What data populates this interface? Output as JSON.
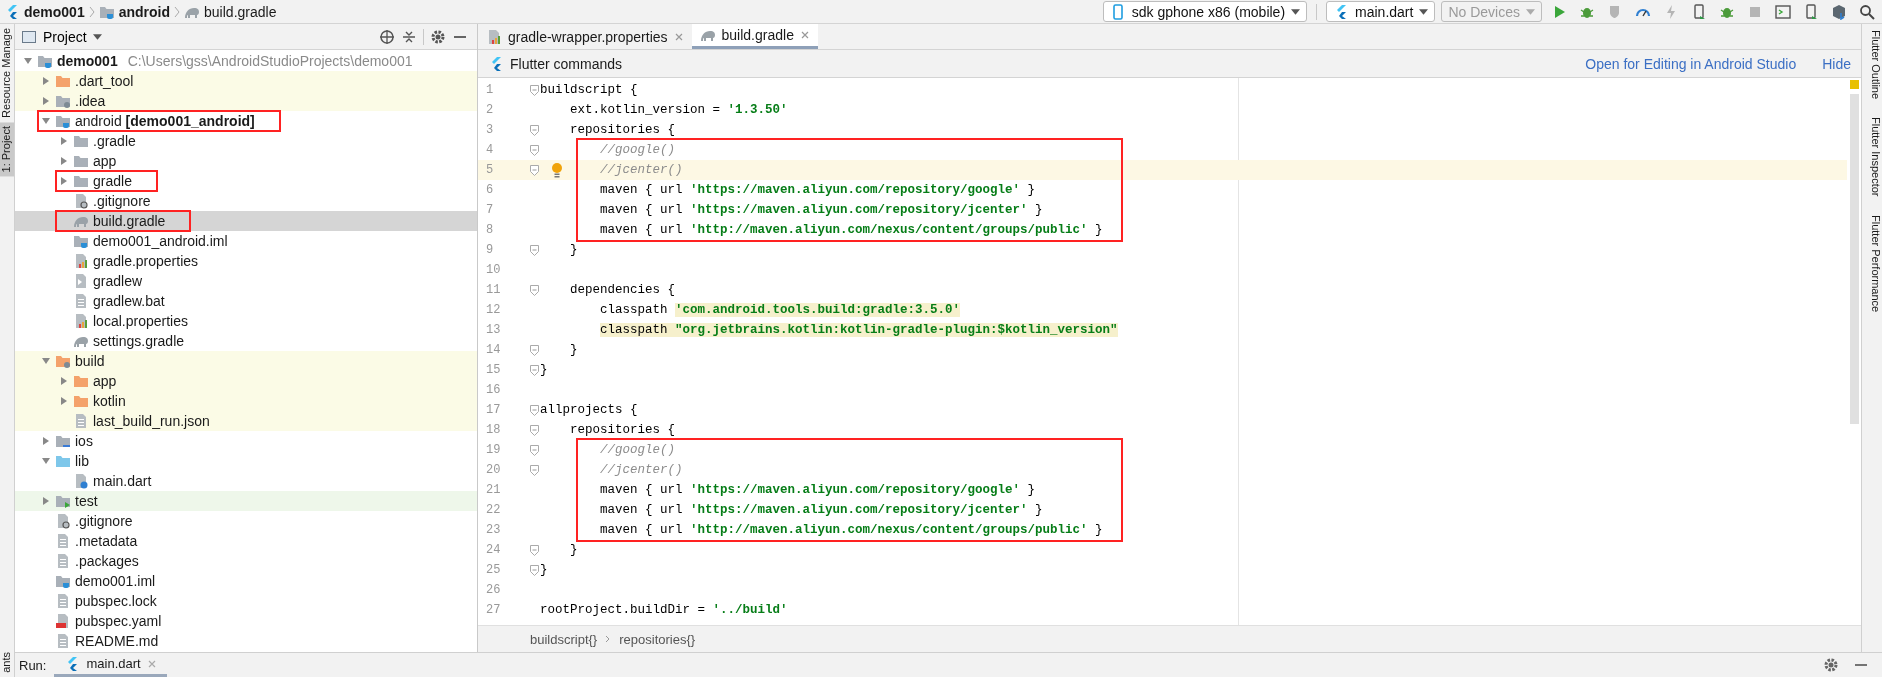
{
  "breadcrumbs": [
    {
      "label": "demo001",
      "kind": "flutter",
      "bold": true
    },
    {
      "label": "android",
      "kind": "module",
      "bold": true
    },
    {
      "label": "build.gradle",
      "kind": "gradle",
      "bold": false
    }
  ],
  "toolbar": {
    "device": "sdk gphone x86 (mobile)",
    "config": "main.dart",
    "target": {
      "label": "No Devices",
      "disabled": true
    },
    "actions": [
      {
        "kind": "run",
        "disabled": false
      },
      {
        "kind": "debug",
        "disabled": false
      },
      {
        "kind": "coverage",
        "disabled": true
      },
      {
        "kind": "profile",
        "disabled": false
      },
      {
        "kind": "reload",
        "disabled": true
      },
      {
        "kind": "attach",
        "disabled": false
      },
      {
        "kind": "debug-attach",
        "disabled": false
      },
      {
        "kind": "stop",
        "disabled": true
      },
      {
        "kind": "terminal",
        "disabled": false
      },
      {
        "kind": "device",
        "disabled": false
      },
      {
        "kind": "package",
        "disabled": false
      },
      {
        "kind": "search",
        "disabled": false
      }
    ]
  },
  "left_strip": {
    "top": [
      {
        "label": "Resource Manage",
        "selected": false
      },
      {
        "label": "1: Project",
        "selected": true
      }
    ],
    "bottom": [
      {
        "label": "ants",
        "selected": false
      }
    ]
  },
  "project_panel": {
    "title": "Project",
    "tree": [
      {
        "label": "demo001",
        "bold": true,
        "note": "C:\\Users\\gss\\AndroidStudioProjects\\demo001",
        "kind": "module",
        "expanded": true,
        "excluded": false,
        "test_root": false,
        "selected": false,
        "annotated": false,
        "children": [
          {
            "label": ".dart_tool",
            "bold": false,
            "kind": "folder-orange",
            "expanded": false,
            "excluded": true,
            "test_root": false,
            "selected": false,
            "annotated": false
          },
          {
            "label": ".idea",
            "bold": false,
            "kind": "folder-gear",
            "expanded": false,
            "excluded": true,
            "test_root": false,
            "selected": false,
            "annotated": false
          },
          {
            "label": "android **[demo001_android]**",
            "bold": false,
            "kind": "module",
            "expanded": true,
            "excluded": false,
            "test_root": false,
            "selected": false,
            "annotated": true,
            "children": [
              {
                "label": ".gradle",
                "bold": false,
                "kind": "folder",
                "expanded": false,
                "excluded": false,
                "test_root": false,
                "selected": false,
                "annotated": false
              },
              {
                "label": "app",
                "bold": false,
                "kind": "folder",
                "expanded": false,
                "excluded": false,
                "test_root": false,
                "selected": false,
                "annotated": false
              },
              {
                "label": "gradle",
                "bold": false,
                "kind": "folder",
                "expanded": false,
                "excluded": false,
                "test_root": false,
                "selected": false,
                "annotated": true
              },
              {
                "label": ".gitignore",
                "bold": false,
                "kind": "ignore",
                "excluded": false,
                "test_root": false,
                "selected": false,
                "annotated": false
              },
              {
                "label": "build.gradle",
                "bold": false,
                "kind": "gradle",
                "excluded": false,
                "test_root": false,
                "selected": true,
                "annotated": true
              },
              {
                "label": "demo001_android.iml",
                "bold": false,
                "kind": "iml",
                "excluded": false,
                "test_root": false,
                "selected": false,
                "annotated": false
              },
              {
                "label": "gradle.properties",
                "bold": false,
                "kind": "properties",
                "excluded": false,
                "test_root": false,
                "selected": false,
                "annotated": false
              },
              {
                "label": "gradlew",
                "bold": false,
                "kind": "script",
                "excluded": false,
                "test_root": false,
                "selected": false,
                "annotated": false
              },
              {
                "label": "gradlew.bat",
                "bold": false,
                "kind": "text",
                "excluded": false,
                "test_root": false,
                "selected": false,
                "annotated": false
              },
              {
                "label": "local.properties",
                "bold": false,
                "kind": "properties",
                "excluded": false,
                "test_root": false,
                "selected": false,
                "annotated": false
              },
              {
                "label": "settings.gradle",
                "bold": false,
                "kind": "gradle",
                "excluded": false,
                "test_root": false,
                "selected": false,
                "annotated": false
              }
            ]
          },
          {
            "label": "build",
            "bold": false,
            "kind": "folder-orange-gear",
            "expanded": true,
            "excluded": true,
            "test_root": false,
            "selected": false,
            "annotated": false,
            "children": [
              {
                "label": "app",
                "bold": false,
                "kind": "folder-orange",
                "expanded": false,
                "excluded": true,
                "test_root": false,
                "selected": false,
                "annotated": false
              },
              {
                "label": "kotlin",
                "bold": false,
                "kind": "folder-orange",
                "expanded": false,
                "excluded": true,
                "test_root": false,
                "selected": false,
                "annotated": false
              },
              {
                "label": "last_build_run.json",
                "bold": false,
                "kind": "json",
                "excluded": true,
                "test_root": false,
                "selected": false,
                "annotated": false
              }
            ]
          },
          {
            "label": "ios",
            "bold": false,
            "kind": "folder-ios",
            "expanded": false,
            "excluded": false,
            "test_root": false,
            "selected": false,
            "annotated": false
          },
          {
            "label": "lib",
            "bold": false,
            "kind": "folder-blue",
            "expanded": true,
            "excluded": false,
            "test_root": false,
            "selected": false,
            "annotated": false,
            "children": [
              {
                "label": "main.dart",
                "bold": false,
                "kind": "dart",
                "excluded": false,
                "test_root": false,
                "selected": false,
                "annotated": false
              }
            ]
          },
          {
            "label": "test",
            "bold": false,
            "kind": "folder-test",
            "expanded": false,
            "excluded": false,
            "test_root": true,
            "selected": false,
            "annotated": false
          },
          {
            "label": ".gitignore",
            "bold": false,
            "kind": "ignore",
            "excluded": false,
            "test_root": false,
            "selected": false,
            "annotated": false
          },
          {
            "label": ".metadata",
            "bold": false,
            "kind": "text",
            "excluded": false,
            "test_root": false,
            "selected": false,
            "annotated": false
          },
          {
            "label": ".packages",
            "bold": false,
            "kind": "text",
            "excluded": false,
            "test_root": false,
            "selected": false,
            "annotated": false
          },
          {
            "label": "demo001.iml",
            "bold": false,
            "kind": "iml",
            "excluded": false,
            "test_root": false,
            "selected": false,
            "annotated": false
          },
          {
            "label": "pubspec.lock",
            "bold": false,
            "kind": "text",
            "excluded": false,
            "test_root": false,
            "selected": false,
            "annotated": false
          },
          {
            "label": "pubspec.yaml",
            "bold": false,
            "kind": "yaml",
            "excluded": false,
            "test_root": false,
            "selected": false,
            "annotated": false
          },
          {
            "label": "README.md",
            "bold": false,
            "kind": "text",
            "excluded": false,
            "test_root": false,
            "selected": false,
            "annotated": false
          }
        ]
      }
    ]
  },
  "editor": {
    "tabs": [
      {
        "label": "gradle-wrapper.properties",
        "kind": "properties",
        "selected": false
      },
      {
        "label": "build.gradle",
        "kind": "gradle",
        "selected": true
      }
    ],
    "banner": {
      "title": "Flutter commands",
      "links": [
        "Open for Editing in Android Studio",
        "Hide"
      ]
    },
    "lines": [
      {
        "number": "1",
        "fold": true,
        "current": false,
        "segments": [
          {
            "kind": "plain",
            "text": "buildscript {"
          }
        ],
        "boxed_children": false,
        "children": [
          {
            "number": "2",
            "fold": false,
            "current": false,
            "segments": [
              {
                "kind": "plain",
                "text": "ext.kotlin_version = "
              },
              {
                "kind": "string",
                "text": "'1.3.50'"
              }
            ]
          },
          {
            "number": "3",
            "fold": true,
            "current": false,
            "segments": [
              {
                "kind": "plain",
                "text": "repositories {"
              }
            ],
            "boxed_children": true,
            "children": [
              {
                "number": "4",
                "fold": true,
                "current": false,
                "segments": [
                  {
                    "kind": "comment",
                    "text": "//google()"
                  }
                ]
              },
              {
                "number": "5",
                "fold": true,
                "current": true,
                "segments": [
                  {
                    "kind": "comment",
                    "text": "//jcenter()"
                  }
                ]
              },
              {
                "number": "6",
                "fold": false,
                "current": false,
                "segments": [
                  {
                    "kind": "plain",
                    "text": "maven { url "
                  },
                  {
                    "kind": "string",
                    "text": "'https://maven.aliyun.com/repository/google'"
                  },
                  {
                    "kind": "plain",
                    "text": " }"
                  }
                ]
              },
              {
                "number": "7",
                "fold": false,
                "current": false,
                "segments": [
                  {
                    "kind": "plain",
                    "text": "maven { url "
                  },
                  {
                    "kind": "string",
                    "text": "'https://maven.aliyun.com/repository/jcenter'"
                  },
                  {
                    "kind": "plain",
                    "text": " }"
                  }
                ]
              },
              {
                "number": "8",
                "fold": false,
                "current": false,
                "segments": [
                  {
                    "kind": "plain",
                    "text": "maven { url "
                  },
                  {
                    "kind": "string",
                    "text": "'http://maven.aliyun.com/nexus/content/groups/public'"
                  },
                  {
                    "kind": "plain",
                    "text": " }"
                  }
                ]
              }
            ]
          },
          {
            "number": "9",
            "fold": true,
            "current": false,
            "segments": [
              {
                "kind": "plain",
                "text": "}"
              }
            ]
          },
          {
            "number": "10",
            "fold": false,
            "current": false
          },
          {
            "number": "11",
            "fold": true,
            "current": false,
            "segments": [
              {
                "kind": "plain",
                "text": "dependencies {"
              }
            ],
            "boxed_children": false,
            "children": [
              {
                "number": "12",
                "fold": false,
                "current": false,
                "segments": [
                  {
                    "kind": "plain",
                    "text": "classpath "
                  },
                  {
                    "kind": "string",
                    "text": "'com.android.tools.build:gradle:3.5.0'",
                    "marked": true
                  }
                ]
              },
              {
                "number": "13",
                "fold": false,
                "current": false,
                "segments": [
                  {
                    "kind": "plain",
                    "text": "classpath ",
                    "marked": true
                  },
                  {
                    "kind": "string",
                    "text": "\"org.jetbrains.kotlin:kotlin-gradle-plugin:$kotlin_version\"",
                    "marked": true
                  }
                ]
              }
            ]
          },
          {
            "number": "14",
            "fold": true,
            "current": false,
            "segments": [
              {
                "kind": "plain",
                "text": "}"
              }
            ]
          }
        ]
      },
      {
        "number": "15",
        "fold": true,
        "current": false,
        "segments": [
          {
            "kind": "plain",
            "text": "}"
          }
        ]
      },
      {
        "number": "16",
        "fold": false,
        "current": false
      },
      {
        "number": "17",
        "fold": true,
        "current": false,
        "segments": [
          {
            "kind": "plain",
            "text": "allprojects {"
          }
        ],
        "boxed_children": false,
        "children": [
          {
            "number": "18",
            "fold": true,
            "current": false,
            "segments": [
              {
                "kind": "plain",
                "text": "repositories {"
              }
            ],
            "boxed_children": true,
            "children": [
              {
                "number": "19",
                "fold": true,
                "current": false,
                "segments": [
                  {
                    "kind": "comment",
                    "text": "//google()"
                  }
                ]
              },
              {
                "number": "20",
                "fold": true,
                "current": false,
                "segments": [
                  {
                    "kind": "comment",
                    "text": "//jcenter()"
                  }
                ]
              },
              {
                "number": "21",
                "fold": false,
                "current": false,
                "segments": [
                  {
                    "kind": "plain",
                    "text": "maven { url "
                  },
                  {
                    "kind": "string",
                    "text": "'https://maven.aliyun.com/repository/google'"
                  },
                  {
                    "kind": "plain",
                    "text": " }"
                  }
                ]
              },
              {
                "number": "22",
                "fold": false,
                "current": false,
                "segments": [
                  {
                    "kind": "plain",
                    "text": "maven { url "
                  },
                  {
                    "kind": "string",
                    "text": "'https://maven.aliyun.com/repository/jcenter'"
                  },
                  {
                    "kind": "plain",
                    "text": " }"
                  }
                ]
              },
              {
                "number": "23",
                "fold": false,
                "current": false,
                "segments": [
                  {
                    "kind": "plain",
                    "text": "maven { url "
                  },
                  {
                    "kind": "string",
                    "text": "'http://maven.aliyun.com/nexus/content/groups/public'"
                  },
                  {
                    "kind": "plain",
                    "text": " }"
                  }
                ]
              }
            ]
          },
          {
            "number": "24",
            "fold": true,
            "current": false,
            "segments": [
              {
                "kind": "plain",
                "text": "}"
              }
            ]
          }
        ]
      },
      {
        "number": "25",
        "fold": true,
        "current": false,
        "segments": [
          {
            "kind": "plain",
            "text": "}"
          }
        ]
      },
      {
        "number": "26",
        "fold": false,
        "current": false
      },
      {
        "number": "27",
        "fold": false,
        "current": false,
        "segments": [
          {
            "kind": "plain",
            "text": "rootProject.buildDir = "
          },
          {
            "kind": "string",
            "text": "'../build'"
          }
        ]
      }
    ],
    "breadcrumbs": [
      "buildscript{}",
      "repositories{}"
    ]
  },
  "right_strip": [
    {
      "label": "Flutter Outline"
    },
    {
      "label": "Flutter Inspector"
    },
    {
      "label": "Flutter Performance"
    }
  ],
  "run_bar": {
    "label": "Run:",
    "tabs": [
      {
        "label": "main.dart",
        "selected": true
      }
    ]
  }
}
